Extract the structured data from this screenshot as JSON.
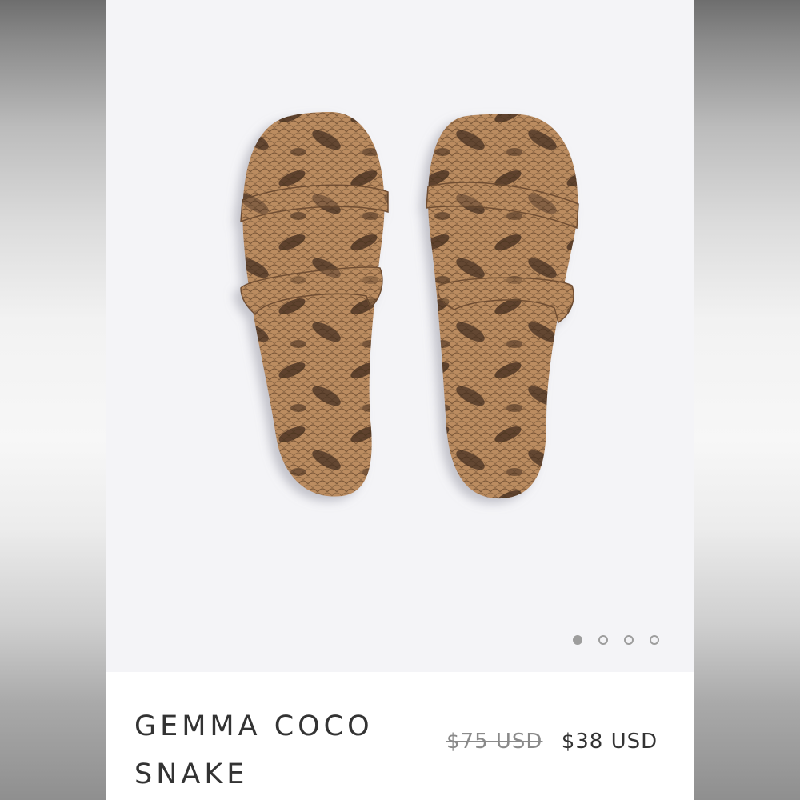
{
  "product": {
    "title": "GEMMA COCO SNAKE",
    "image_description": "snakeskin-print two-strap slide sandals",
    "original_price": "$75 USD",
    "sale_price": "$38 USD"
  },
  "carousel": {
    "total_slides": 4,
    "active_index": 0
  },
  "colors": {
    "image_background": "#f4f4f7",
    "text": "#333333",
    "strikethrough_price": "#8a8a8a",
    "dot": "#9d9d9d",
    "snake_base": "#b98a5e",
    "snake_dark": "#3e2a1c"
  }
}
